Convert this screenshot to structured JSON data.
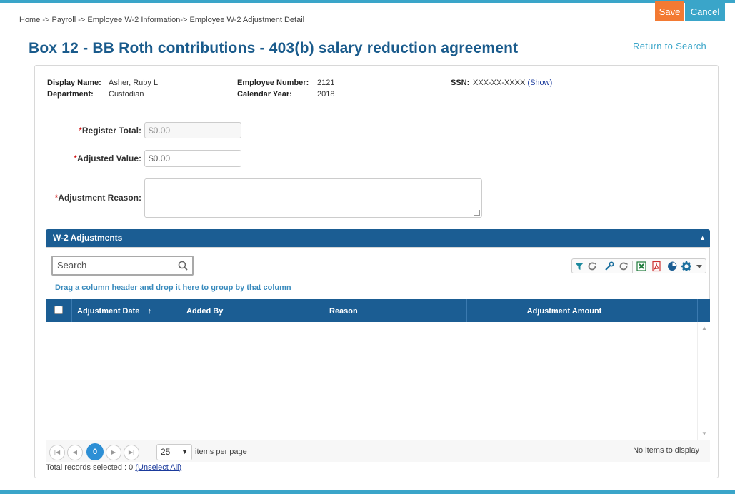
{
  "header": {
    "breadcrumb": "Home -> Payroll -> Employee W-2 Information-> Employee W-2 Adjustment Detail",
    "save_label": "Save",
    "cancel_label": "Cancel",
    "title": "Box 12 - BB Roth contributions - 403(b) salary reduction agreement",
    "return_link": "Return to Search"
  },
  "employee": {
    "display_name_label": "Display Name:",
    "display_name": "Asher, Ruby L",
    "department_label": "Department:",
    "department": "Custodian",
    "employee_number_label": "Employee Number:",
    "employee_number": "2121",
    "calendar_year_label": "Calendar Year:",
    "calendar_year": "2018",
    "ssn_label": "SSN:",
    "ssn": "XXX-XX-XXXX",
    "ssn_show": "(Show)"
  },
  "form": {
    "register_total_label": "Register Total:",
    "register_total_value": "$0.00",
    "adjusted_value_label": "Adjusted Value:",
    "adjusted_value": "$0.00",
    "adjustment_reason_label": "Adjustment Reason:",
    "adjustment_reason_value": "",
    "required_mark": "*"
  },
  "grid": {
    "section_title": "W-2 Adjustments",
    "collapse_glyph": "▲",
    "search_placeholder": "Search",
    "group_hint": "Drag a column header and drop it here to group by that column",
    "columns": [
      "Adjustment Date",
      "Added By",
      "Reason",
      "Adjustment Amount"
    ],
    "sort_indicator": "↑",
    "rows": [],
    "pager": {
      "current_page": "0",
      "page_size": "25",
      "items_per_page_label": "items per page",
      "status": "No items to display"
    },
    "footer_prefix": "Total records selected : 0",
    "unselect_all": "(Unselect All)"
  },
  "toolbar_icons": [
    "filter-icon",
    "refresh-icon",
    "wrench-icon",
    "refresh-icon",
    "excel-icon",
    "pdf-icon",
    "chart-icon",
    "gear-icon"
  ],
  "colors": {
    "accent": "#3aa5c9",
    "save": "#f37a33",
    "header_blue": "#1b5d93",
    "title_blue": "#1a5b8c"
  }
}
